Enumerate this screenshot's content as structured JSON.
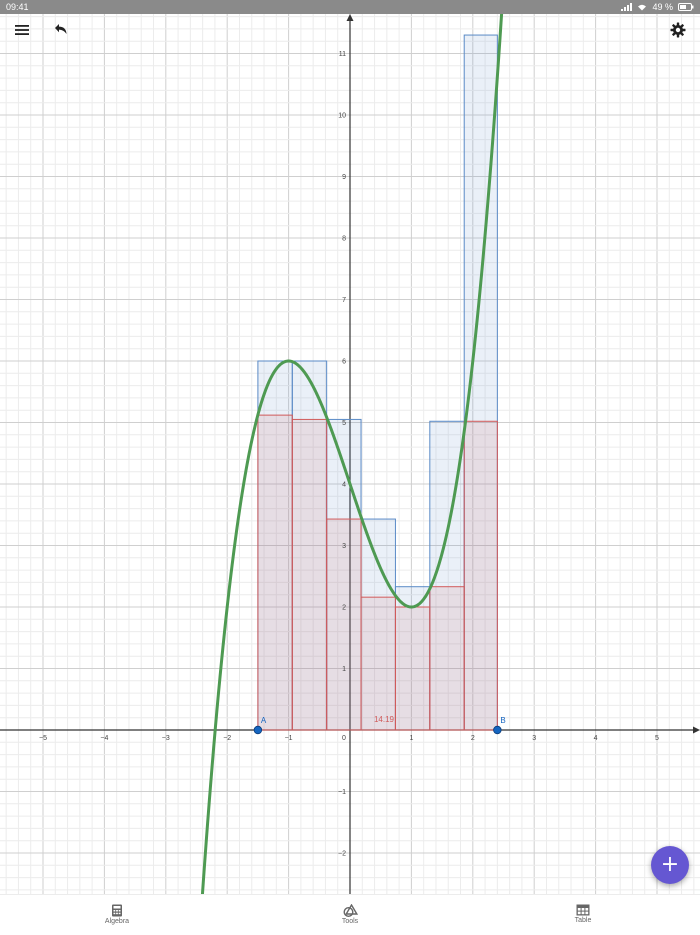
{
  "status": {
    "time": "09:41",
    "battery": "49 %"
  },
  "toolbar": {
    "menu_icon": "menu-icon",
    "undo_icon": "undo-icon",
    "settings_icon": "gear-icon"
  },
  "graph": {
    "x_ticks": [
      "−5",
      "−4",
      "−3",
      "−2",
      "−1",
      "0",
      "1",
      "2",
      "3",
      "4",
      "5"
    ],
    "y_ticks": [
      "−2",
      "−1",
      "1",
      "2",
      "3",
      "4",
      "5",
      "6",
      "7",
      "8",
      "9",
      "10",
      "11"
    ],
    "point_a": "A",
    "point_b": "B",
    "sum_label": "14.19",
    "colors": {
      "curve": "#4e9a52",
      "upper": "#5a8ac6",
      "lower": "#d05a5a",
      "point": "#1565c0",
      "axis": "#333333"
    }
  },
  "chart_data": {
    "type": "line",
    "function": "f(x) = x^3 - 3x + 4",
    "interval": [
      -1.5,
      2.4
    ],
    "point_a": {
      "label": "A",
      "x": -1.5,
      "y": 0
    },
    "point_b": {
      "label": "B",
      "x": 2.4,
      "y": 0
    },
    "rectangles": {
      "x_edges": [
        -1.5,
        -0.94,
        -0.38,
        0.18,
        0.74,
        1.3,
        1.86,
        2.4
      ],
      "upper": [
        6.0,
        6.0,
        5.05,
        3.43,
        2.33,
        5.02,
        11.3
      ],
      "lower": [
        5.12,
        5.05,
        3.43,
        2.16,
        2.0,
        2.33,
        5.02
      ]
    },
    "lower_sum": "14.19",
    "xlim": [
      -5.7,
      5.7
    ],
    "ylim": [
      -2.6,
      11.7
    ],
    "grid": true
  },
  "fab": {
    "label": "+"
  },
  "tabs": [
    {
      "label": "Algebra",
      "icon": "calculator-icon"
    },
    {
      "label": "Tools",
      "icon": "shapes-icon"
    },
    {
      "label": "Table",
      "icon": "table-icon"
    }
  ]
}
